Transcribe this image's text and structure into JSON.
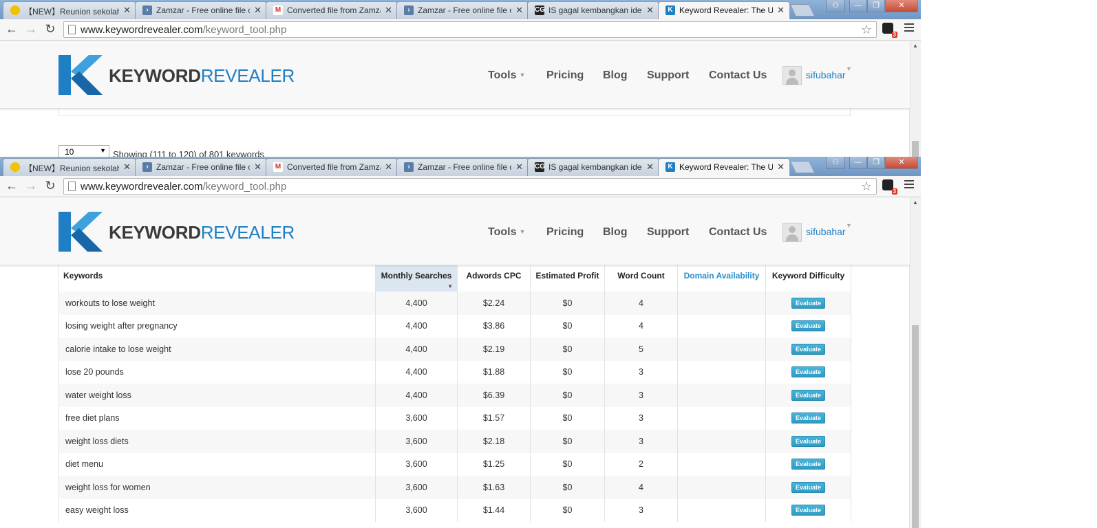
{
  "browser": {
    "tabs": [
      {
        "title": "【NEW】Reunion sekolah",
        "favicon": "pacman-icon",
        "color": "#f2c200"
      },
      {
        "title": "Zamzar - Free online file co",
        "favicon": "zamzar-icon",
        "color": "#5a7da8"
      },
      {
        "title": "Converted file from Zamza",
        "favicon": "gmail-icon",
        "color": "#d93025"
      },
      {
        "title": "Zamzar - Free online file co",
        "favicon": "zamzar-icon",
        "color": "#5a7da8"
      },
      {
        "title": "IS gagal kembangkan idec",
        "favicon": "cg-icon",
        "color": "#222222"
      },
      {
        "title": "Keyword Revealer: The Ult",
        "favicon": "keyword-revealer-icon",
        "color": "#1e7fc4"
      }
    ],
    "url_host": "www.keywordrevealer.com",
    "url_path": "/keyword_tool.php",
    "extension_badge": "3"
  },
  "site": {
    "logo_part1": "KEYWORD",
    "logo_part2": "REVEALER",
    "nav": {
      "tools": "Tools",
      "pricing": "Pricing",
      "blog": "Blog",
      "support": "Support",
      "contact": "Contact Us"
    },
    "username": "sifubahar",
    "accent_color": "#1e7fc4"
  },
  "pagination": {
    "per_page": "10",
    "showing": "Showing (111 to 120) of 801 keywords"
  },
  "table": {
    "headers": {
      "keywords": "Keywords",
      "monthly": "Monthly Searches",
      "cpc": "Adwords CPC",
      "profit": "Estimated Profit",
      "words": "Word Count",
      "domain": "Domain Availability",
      "difficulty": "Keyword Difficulty"
    },
    "sorted_column": "Monthly Searches",
    "evaluate_label": "Evaluate",
    "rows": [
      {
        "keyword": "workouts to lose weight",
        "monthly": "4,400",
        "cpc": "$2.24",
        "profit": "$0",
        "words": "4"
      },
      {
        "keyword": "losing weight after pregnancy",
        "monthly": "4,400",
        "cpc": "$3.86",
        "profit": "$0",
        "words": "4"
      },
      {
        "keyword": "calorie intake to lose weight",
        "monthly": "4,400",
        "cpc": "$2.19",
        "profit": "$0",
        "words": "5"
      },
      {
        "keyword": "lose 20 pounds",
        "monthly": "4,400",
        "cpc": "$1.88",
        "profit": "$0",
        "words": "3"
      },
      {
        "keyword": "water weight loss",
        "monthly": "4,400",
        "cpc": "$6.39",
        "profit": "$0",
        "words": "3"
      },
      {
        "keyword": "free diet plans",
        "monthly": "3,600",
        "cpc": "$1.57",
        "profit": "$0",
        "words": "3"
      },
      {
        "keyword": "weight loss diets",
        "monthly": "3,600",
        "cpc": "$2.18",
        "profit": "$0",
        "words": "3"
      },
      {
        "keyword": "diet menu",
        "monthly": "3,600",
        "cpc": "$1.25",
        "profit": "$0",
        "words": "2"
      },
      {
        "keyword": "weight loss for women",
        "monthly": "3,600",
        "cpc": "$1.63",
        "profit": "$0",
        "words": "4"
      },
      {
        "keyword": "easy weight loss",
        "monthly": "3,600",
        "cpc": "$1.44",
        "profit": "$0",
        "words": "3"
      }
    ]
  }
}
